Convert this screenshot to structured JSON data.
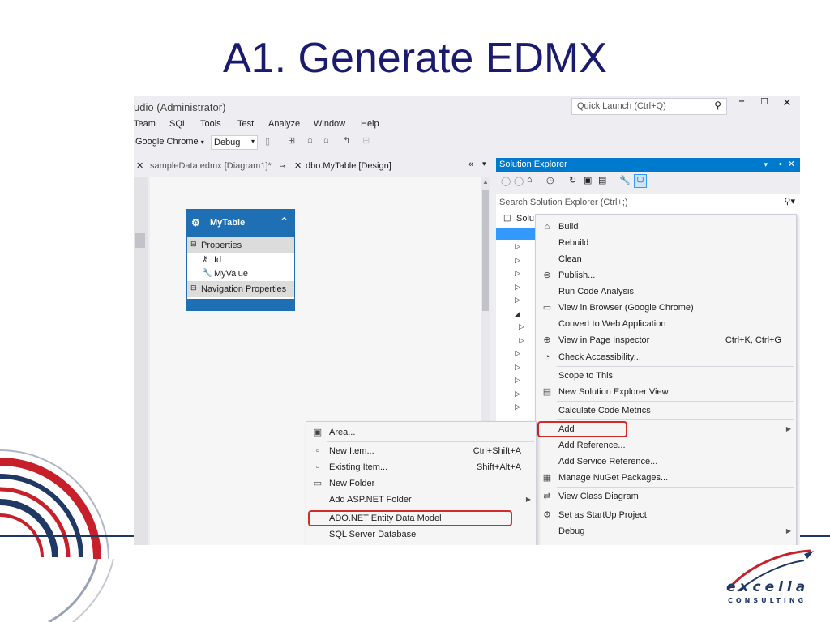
{
  "slide": {
    "title": "A1. Generate EDMX",
    "logo": {
      "text": "excella",
      "sub": "CONSULTING"
    }
  },
  "vs": {
    "window_title": "udio (Administrator)",
    "quick_launch_placeholder": "Quick Launch (Ctrl+Q)",
    "menu": [
      "Team",
      "SQL",
      "Tools",
      "Test",
      "Analyze",
      "Window",
      "Help"
    ],
    "toolbar": {
      "browser": "Google Chrome",
      "config": "Debug"
    },
    "tabs": [
      {
        "label": "sampleData.edmx [Diagram1]*",
        "active": false
      },
      {
        "label": "dbo.MyTable [Design]",
        "active": true
      }
    ],
    "entity": {
      "name": "MyTable",
      "properties_header": "Properties",
      "properties": [
        "Id",
        "MyValue"
      ],
      "nav_header": "Navigation Properties"
    },
    "solution_explorer": {
      "title": "Solution Explorer",
      "search_placeholder": "Search Solution Explorer (Ctrl+;)",
      "tree_first": "Solu"
    },
    "project_menu": [
      {
        "label": "Build",
        "icon": "build-icon"
      },
      {
        "label": "Rebuild"
      },
      {
        "label": "Clean"
      },
      {
        "label": "Publish...",
        "icon": "publish-icon"
      },
      {
        "label": "Run Code Analysis"
      },
      {
        "label": "View in Browser (Google Chrome)",
        "icon": "browser-icon"
      },
      {
        "label": "Convert to Web Application"
      },
      {
        "label": "View in Page Inspector",
        "shortcut": "Ctrl+K, Ctrl+G",
        "icon": "inspector-icon"
      },
      {
        "label": "Check Accessibility...",
        "icon": "accessibility-icon"
      },
      {
        "label": "Scope to This"
      },
      {
        "label": "New Solution Explorer View",
        "icon": "new-view-icon"
      },
      {
        "label": "Calculate Code Metrics"
      },
      {
        "label": "Add",
        "highlighted": true,
        "submenu": true
      },
      {
        "label": "Add Reference..."
      },
      {
        "label": "Add Service Reference..."
      },
      {
        "label": "Manage NuGet Packages...",
        "icon": "nuget-icon"
      },
      {
        "label": "View Class Diagram",
        "icon": "class-diagram-icon"
      },
      {
        "label": "Set as StartUp Project",
        "icon": "gear-icon"
      },
      {
        "label": "Debug",
        "submenu": true
      }
    ],
    "add_menu": [
      {
        "label": "Area...",
        "icon": "area-icon"
      },
      {
        "label": "New Item...",
        "shortcut": "Ctrl+Shift+A",
        "icon": "new-item-icon"
      },
      {
        "label": "Existing Item...",
        "shortcut": "Shift+Alt+A",
        "icon": "existing-item-icon"
      },
      {
        "label": "New Folder",
        "icon": "folder-icon"
      },
      {
        "label": "Add ASP.NET Folder",
        "submenu": true
      },
      {
        "label": "ADO.NET Entity Data Model",
        "highlighted": true
      },
      {
        "label": "SQL Server Database"
      }
    ]
  },
  "colors": {
    "title": "#1a1a6e",
    "accent": "#007acc",
    "highlight_box": "#d22b2b",
    "entity": "#1e6fb3"
  }
}
